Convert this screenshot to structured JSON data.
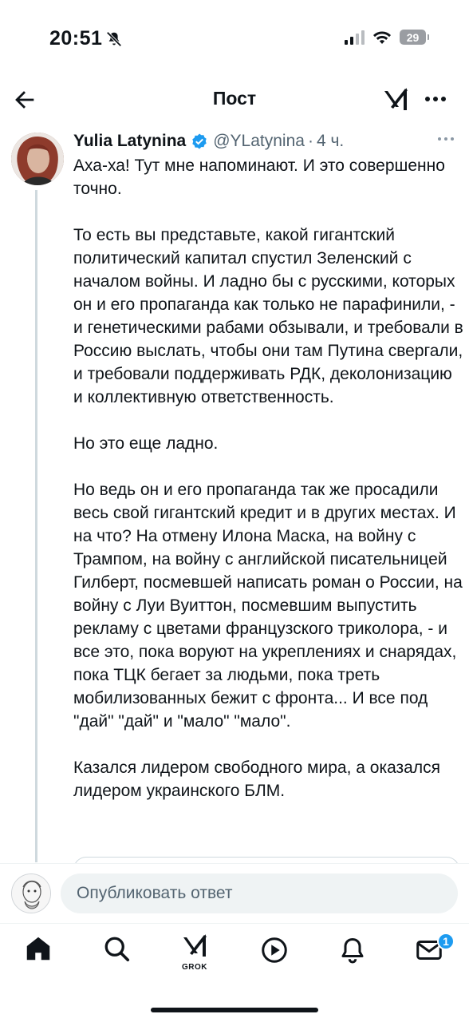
{
  "status_bar": {
    "time": "20:51",
    "battery": "29"
  },
  "header": {
    "title": "Пост"
  },
  "post": {
    "author_name": "Yulia Latynina",
    "handle": "@YLatynina",
    "separator": "·",
    "time": "4 ч.",
    "paragraphs": [
      "Аха-ха! Тут мне напоминают. И это совершенно точно.",
      "То есть вы представьте, какой гигантский политический капитал спустил Зеленский с началом войны. И ладно бы с русскими, которых он и его пропаганда как только не парафинили, - и генетическими рабами обзывали, и требовали в Россию выслать, чтобы они там Путина свергали, и требовали поддерживать РДК, деколонизацию и коллективную ответственность.",
      "Но это еще ладно.",
      "Но ведь он и его пропаганда так же просадили весь свой гигантский кредит и в других местах. И на что? На отмену Илона Маска, на войну с Трампом, на войну с английской писательницей Гилберт, посмевшей написать роман о России, на войну с Луи Вуиттон, посмевшим выпустить рекламу с цветами французского триколора, - и все это, пока воруют на укреплениях и снарядах, пока ТЦК бегает за людьми, пока треть мобилизованных бежит с фронта... И все под \"дай\" \"дай\" и \"мало\" \"мало\".",
      "Казался лидером свободного мира, а оказался лидером украинского БЛМ."
    ]
  },
  "reply": {
    "placeholder": "Опубликовать ответ"
  },
  "nav": {
    "grok_label": "GROK",
    "messages_badge": "1"
  },
  "icons": {
    "back": "arrow-left-icon",
    "grok": "grok-icon",
    "more": "more-horizontal-icon",
    "verified": "verified-badge-icon",
    "home": "home-icon",
    "search": "search-icon",
    "video": "play-circle-icon",
    "notifications": "bell-icon",
    "messages": "envelope-icon",
    "bell_off": "bell-slash-icon",
    "wifi": "wifi-icon",
    "signal": "cellular-signal-icon"
  },
  "colors": {
    "accent": "#1d9bf0",
    "text": "#0f1419",
    "secondary": "#536471",
    "border": "#cfd9de"
  }
}
